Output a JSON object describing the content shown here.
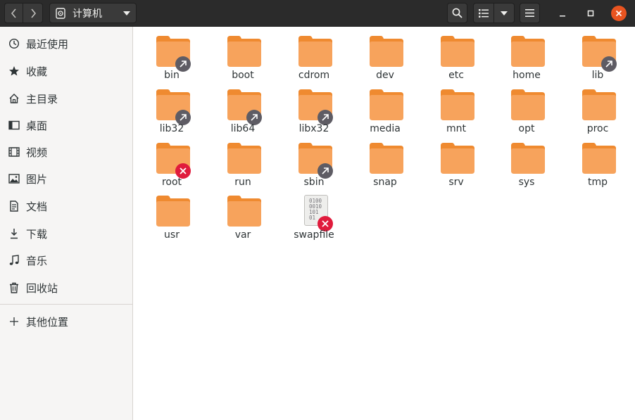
{
  "window": {
    "location": "计算机",
    "colors": {
      "headerbar": "#2b2b2b",
      "close_button": "#e95420",
      "folder": "#f7a35c",
      "folder_tab": "#ef8a30",
      "link_emblem": "#5e5c64",
      "unreadable_emblem": "#e01b3c"
    }
  },
  "toolbar": {
    "back_icon": "chevron-left-icon",
    "forward_icon": "chevron-right-icon",
    "location_icon": "drive-icon",
    "search_icon": "search-icon",
    "view_icon": "list-view-icon",
    "view_options_icon": "chevron-down-icon",
    "menu_icon": "hamburger-icon",
    "minimize_icon": "minimize-icon",
    "maximize_icon": "maximize-icon",
    "close_icon": "close-icon"
  },
  "sidebar": {
    "items": [
      {
        "label": "最近使用",
        "icon": "clock-icon"
      },
      {
        "label": "收藏",
        "icon": "star-icon"
      },
      {
        "label": "主目录",
        "icon": "home-icon"
      },
      {
        "label": "桌面",
        "icon": "desktop-icon"
      },
      {
        "label": "视频",
        "icon": "video-icon"
      },
      {
        "label": "图片",
        "icon": "picture-icon"
      },
      {
        "label": "文档",
        "icon": "document-icon"
      },
      {
        "label": "下载",
        "icon": "download-icon"
      },
      {
        "label": "音乐",
        "icon": "music-icon"
      },
      {
        "label": "回收站",
        "icon": "trash-icon"
      }
    ],
    "other_locations": {
      "label": "其他位置",
      "icon": "plus-icon"
    }
  },
  "files": [
    {
      "name": "bin",
      "emblem": "link"
    },
    {
      "name": "boot",
      "emblem": ""
    },
    {
      "name": "cdrom",
      "emblem": ""
    },
    {
      "name": "dev",
      "emblem": ""
    },
    {
      "name": "etc",
      "emblem": ""
    },
    {
      "name": "home",
      "emblem": ""
    },
    {
      "name": "lib",
      "emblem": "link"
    },
    {
      "name": "lib32",
      "emblem": "link"
    },
    {
      "name": "lib64",
      "emblem": "link"
    },
    {
      "name": "libx32",
      "emblem": "link"
    },
    {
      "name": "media",
      "emblem": ""
    },
    {
      "name": "mnt",
      "emblem": ""
    },
    {
      "name": "opt",
      "emblem": ""
    },
    {
      "name": "proc",
      "emblem": ""
    },
    {
      "name": "root",
      "emblem": "unreadable"
    },
    {
      "name": "run",
      "emblem": ""
    },
    {
      "name": "sbin",
      "emblem": "link"
    },
    {
      "name": "snap",
      "emblem": ""
    },
    {
      "name": "srv",
      "emblem": ""
    },
    {
      "name": "sys",
      "emblem": ""
    },
    {
      "name": "tmp",
      "emblem": ""
    },
    {
      "name": "usr",
      "emblem": ""
    },
    {
      "name": "var",
      "emblem": ""
    },
    {
      "name": "swapfile",
      "emblem": "unreadable",
      "type": "binary"
    }
  ],
  "binary_icon_text": [
    "0100",
    "0010",
    "101",
    "01"
  ]
}
